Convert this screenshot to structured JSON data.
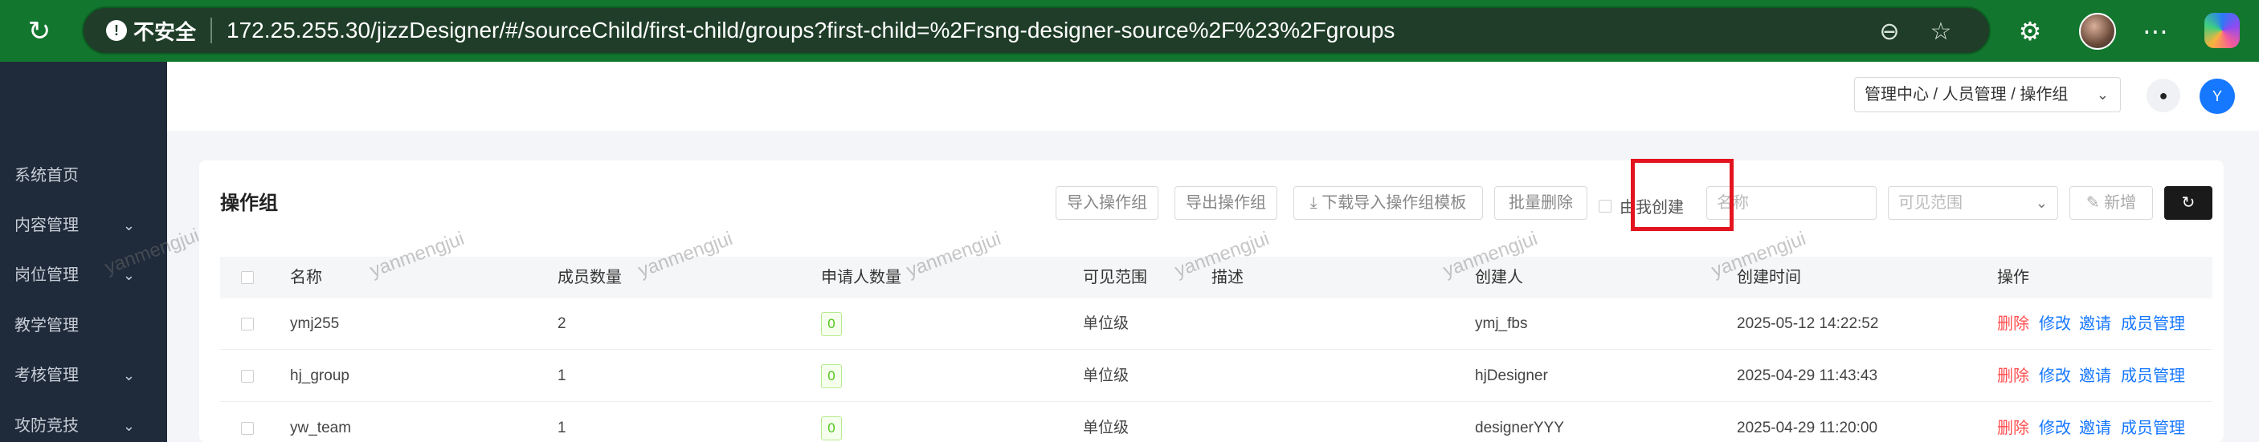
{
  "browser": {
    "security_label": "不安全",
    "url": "172.25.255.30/jizzDesigner/#/sourceChild/first-child/groups?first-child=%2Frsng-designer-source%2F%23%2Fgroups"
  },
  "sidebar": {
    "items": [
      {
        "label": "系统首页",
        "has_chevron": false
      },
      {
        "label": "内容管理",
        "has_chevron": true
      },
      {
        "label": "岗位管理",
        "has_chevron": true
      },
      {
        "label": "教学管理",
        "has_chevron": false
      },
      {
        "label": "考核管理",
        "has_chevron": true
      },
      {
        "label": "攻防竞技",
        "has_chevron": true
      }
    ]
  },
  "header": {
    "breadcrumb": "管理中心 / 人员管理 / 操作组",
    "avatar_letter": "Y"
  },
  "toolbar": {
    "title": "操作组",
    "import_label": "导入操作组",
    "export_label": "导出操作组",
    "download_template_label": "下载导入操作组模板",
    "batch_delete_label": "批量删除",
    "created_by_me_label": "由我创建",
    "name_placeholder": "名称",
    "scope_placeholder": "可见范围",
    "add_label": "新增"
  },
  "table": {
    "columns": [
      "名称",
      "成员数量",
      "申请人数量",
      "可见范围",
      "描述",
      "创建人",
      "创建时间",
      "操作"
    ],
    "rows": [
      {
        "name": "ymj255",
        "members": "2",
        "applicants": "0",
        "scope": "单位级",
        "description": "",
        "creator": "ymj_fbs",
        "created_at": "2025-05-12 14:22:52"
      },
      {
        "name": "hj_group",
        "members": "1",
        "applicants": "0",
        "scope": "单位级",
        "description": "",
        "creator": "hjDesigner",
        "created_at": "2025-04-29 11:43:43"
      },
      {
        "name": "yw_team",
        "members": "1",
        "applicants": "0",
        "scope": "单位级",
        "description": "",
        "creator": "designerYYY",
        "created_at": "2025-04-29 11:20:00"
      }
    ],
    "actions": {
      "delete": "删除",
      "edit": "修改",
      "invite": "邀请",
      "members": "成员管理"
    }
  },
  "watermark": "yanmengjui",
  "colors": {
    "browser_bar": "#12762e",
    "sidebar": "#1f2a3a",
    "primary": "#1677ff",
    "danger": "#ff4d4f",
    "highlight": "#e3141f"
  }
}
